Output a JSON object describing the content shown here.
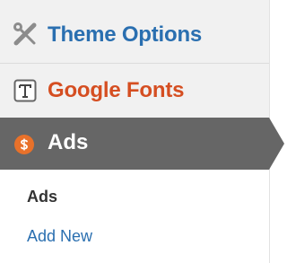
{
  "menu": {
    "items": [
      {
        "label": "Theme Options",
        "icon": "tools-icon"
      },
      {
        "label": "Google Fonts",
        "icon": "font-T-icon"
      },
      {
        "label": "Ads",
        "icon": "dollar-icon",
        "active": true
      }
    ],
    "submenu": {
      "items": [
        {
          "label": "Ads",
          "current": true
        },
        {
          "label": "Add New"
        }
      ]
    }
  },
  "colors": {
    "link_blue": "#2a6fb0",
    "link_orange": "#d54e21",
    "active_bg": "#666666",
    "icon_orange": "#e8712a"
  }
}
